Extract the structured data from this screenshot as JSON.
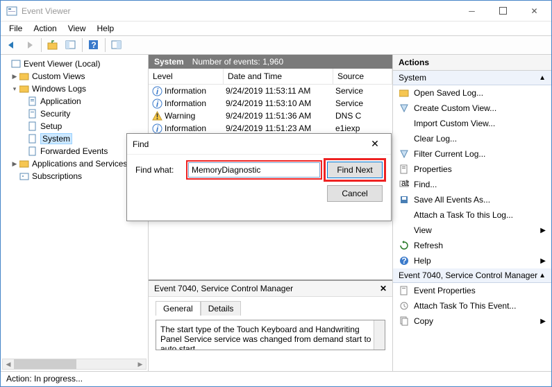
{
  "window": {
    "title": "Event Viewer"
  },
  "menu": {
    "file": "File",
    "action": "Action",
    "view": "View",
    "help": "Help"
  },
  "tree": {
    "root": "Event Viewer (Local)",
    "custom_views": "Custom Views",
    "windows_logs": "Windows Logs",
    "application": "Application",
    "security": "Security",
    "setup": "Setup",
    "system": "System",
    "forwarded": "Forwarded Events",
    "apps_services": "Applications and Services",
    "subscriptions": "Subscriptions"
  },
  "center": {
    "pane_title": "System",
    "event_count_label": "Number of events: 1,960",
    "columns": {
      "level": "Level",
      "dt": "Date and Time",
      "src": "Source"
    },
    "rows": [
      {
        "icon": "info",
        "level": "Information",
        "dt": "9/24/2019 11:53:11 AM",
        "src": "Service"
      },
      {
        "icon": "info",
        "level": "Information",
        "dt": "9/24/2019 11:53:10 AM",
        "src": "Service"
      },
      {
        "icon": "warn",
        "level": "Warning",
        "dt": "9/24/2019 11:51:36 AM",
        "src": "DNS C"
      },
      {
        "icon": "info",
        "level": "Information",
        "dt": "9/24/2019 11:51:23 AM",
        "src": "e1iexp"
      }
    ],
    "event_head": "Event 7040, Service Control Manager",
    "tabs": {
      "general": "General",
      "details": "Details"
    },
    "description": "The start type of the Touch Keyboard and Handwriting Panel Service service was changed from demand start to auto start."
  },
  "actions": {
    "title": "Actions",
    "system": "System",
    "items1": [
      "Open Saved Log...",
      "Create Custom View...",
      "Import Custom View...",
      "Clear Log...",
      "Filter Current Log...",
      "Properties",
      "Find...",
      "Save All Events As...",
      "Attach a Task To this Log..."
    ],
    "view": "View",
    "refresh": "Refresh",
    "help": "Help",
    "section2": "Event 7040, Service Control Manager",
    "items2": [
      "Event Properties",
      "Attach Task To This Event...",
      "Copy"
    ]
  },
  "find": {
    "title": "Find",
    "label": "Find what:",
    "value": "MemoryDiagnostic",
    "find_next": "Find Next",
    "cancel": "Cancel"
  },
  "status": {
    "label": "Action:",
    "value": "In progress..."
  }
}
